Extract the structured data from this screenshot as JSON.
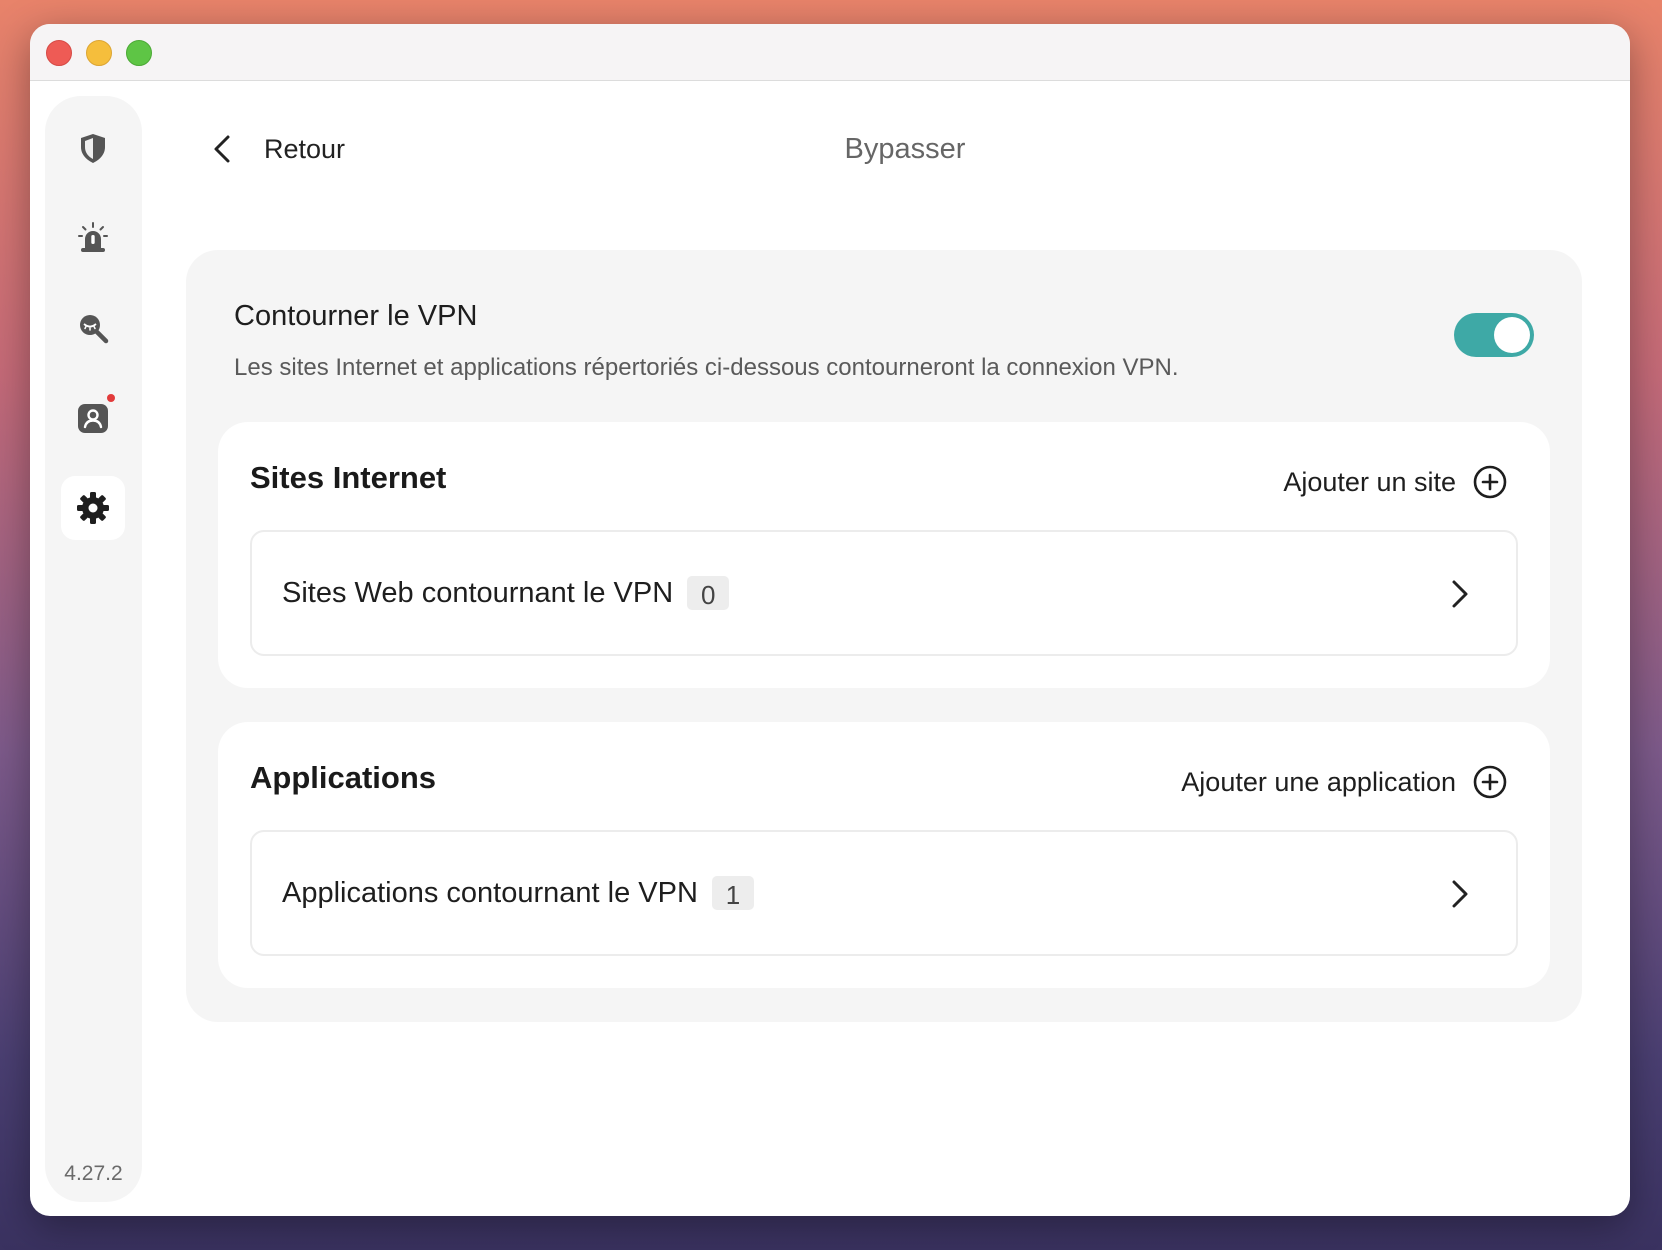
{
  "header": {
    "back_label": "Retour",
    "title": "Bypasser"
  },
  "sidebar": {
    "items": [
      {
        "icon": "shield-icon",
        "active": false
      },
      {
        "icon": "alarm-icon",
        "active": false
      },
      {
        "icon": "search-eye-icon",
        "active": false
      },
      {
        "icon": "account-icon",
        "active": false,
        "notification_dot": true
      },
      {
        "icon": "gear-icon",
        "active": true
      }
    ],
    "version": "4.27.2"
  },
  "bypass": {
    "title": "Contourner le VPN",
    "description": "Les sites Internet et applications répertoriés ci-dessous contourneront la connexion VPN.",
    "enabled": true
  },
  "sites": {
    "title": "Sites Internet",
    "add_label": "Ajouter un site",
    "row_label": "Sites Web contournant le VPN",
    "count": "0"
  },
  "apps": {
    "title": "Applications",
    "add_label": "Ajouter une application",
    "row_label": "Applications contournant le VPN",
    "count": "1"
  },
  "colors": {
    "accent": "#3ea9a6",
    "notification": "#e23b3b"
  }
}
